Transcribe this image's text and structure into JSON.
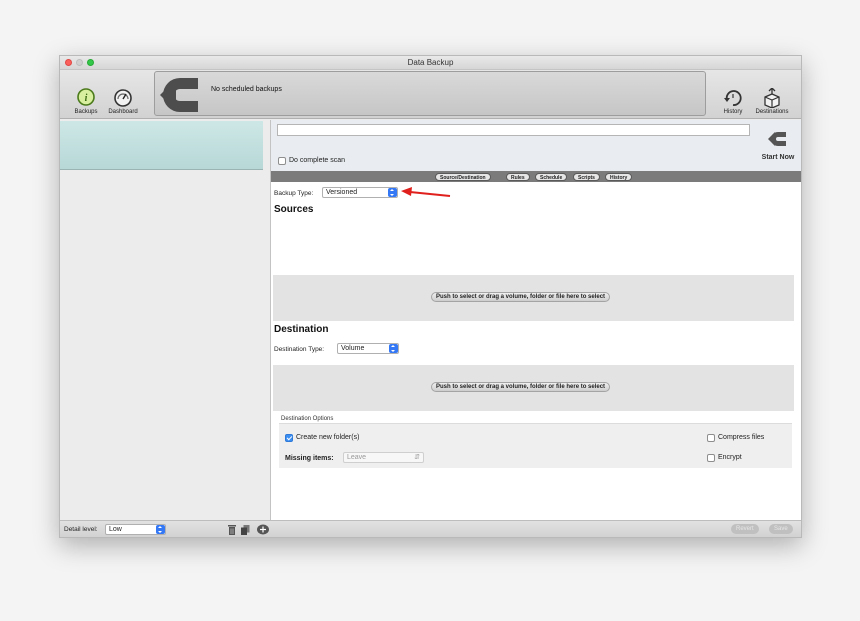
{
  "window": {
    "title": "Data Backup"
  },
  "toolbar": {
    "backups_label": "Backups",
    "dashboard_label": "Dashboard",
    "status_text": "No scheduled backups",
    "history_label": "History",
    "destinations_label": "Destinations"
  },
  "main": {
    "name_value": "",
    "complete_scan_label": "Do complete scan",
    "complete_scan_checked": false,
    "start_now_label": "Start Now",
    "tabs": [
      {
        "label": "Source/Destination"
      },
      {
        "label": "Rules"
      },
      {
        "label": "Schedule"
      },
      {
        "label": "Scripts"
      },
      {
        "label": "History"
      }
    ],
    "backup_type_label": "Backup Type:",
    "backup_type_value": "Versioned",
    "sources_title": "Sources",
    "sources_drop_label": "Push to select or drag a volume, folder or file here to select",
    "destination_title": "Destination",
    "destination_type_label": "Destination Type:",
    "destination_type_value": "Volume",
    "destination_drop_label": "Push to select or drag a volume, folder or file here to select",
    "destination_options_label": "Destination Options",
    "create_folder_label": "Create new folder(s)",
    "create_folder_checked": true,
    "missing_items_label": "Missing items:",
    "missing_items_value": "Leave",
    "compress_label": "Compress files",
    "compress_checked": false,
    "encrypt_label": "Encrypt",
    "encrypt_checked": false
  },
  "bottom": {
    "detail_level_label": "Detail level:",
    "detail_level_value": "Low",
    "revert_label": "Revert",
    "save_label": "Save"
  },
  "colors": {
    "accent_blue": "#3478f6",
    "sidebar_selection": "#c3e0df",
    "annotation_arrow": "#e0201c"
  }
}
